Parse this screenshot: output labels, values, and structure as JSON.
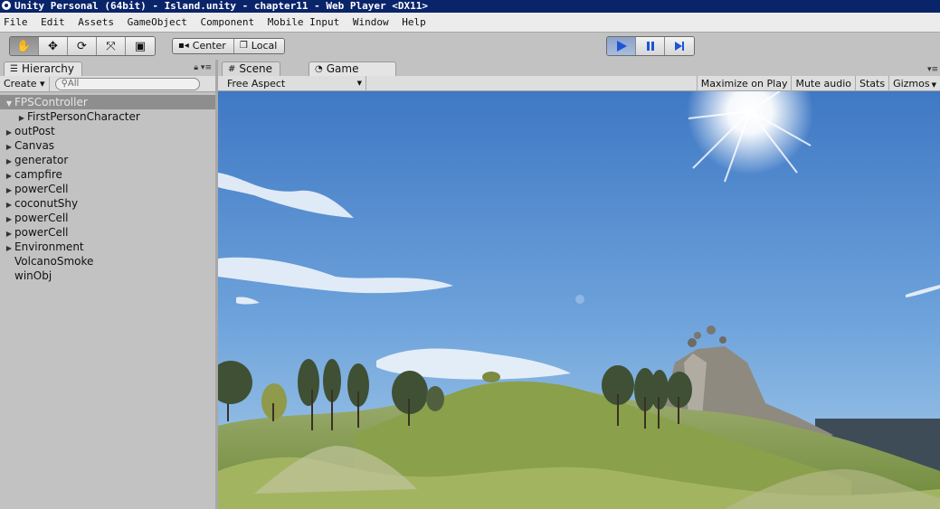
{
  "window": {
    "title": "Unity Personal (64bit) - Island.unity - chapter11 - Web Player <DX11>"
  },
  "menu": [
    "File",
    "Edit",
    "Assets",
    "GameObject",
    "Component",
    "Mobile Input",
    "Window",
    "Help"
  ],
  "toolbar": {
    "transform_tools": [
      {
        "name": "hand-tool-icon",
        "glyph": "✋"
      },
      {
        "name": "move-tool-icon",
        "glyph": "✥"
      },
      {
        "name": "rotate-tool-icon",
        "glyph": "⟳"
      },
      {
        "name": "scale-tool-icon",
        "glyph": "⤧"
      },
      {
        "name": "rect-tool-icon",
        "glyph": "▣"
      }
    ],
    "pivot_label": "Center",
    "space_label": "Local"
  },
  "hierarchy": {
    "tab_label": "Hierarchy",
    "create_label": "Create",
    "search_placeholder": "All",
    "items": [
      {
        "label": "FPSController",
        "depth": 0,
        "arrow": "down",
        "selected": true
      },
      {
        "label": "FirstPersonCharacter",
        "depth": 1,
        "arrow": "right",
        "selected": false
      },
      {
        "label": "outPost",
        "depth": 0,
        "arrow": "right",
        "selected": false
      },
      {
        "label": "Canvas",
        "depth": 0,
        "arrow": "right",
        "selected": false
      },
      {
        "label": "generator",
        "depth": 0,
        "arrow": "right",
        "selected": false
      },
      {
        "label": "campfire",
        "depth": 0,
        "arrow": "right",
        "selected": false
      },
      {
        "label": "powerCell",
        "depth": 0,
        "arrow": "right",
        "selected": false
      },
      {
        "label": "coconutShy",
        "depth": 0,
        "arrow": "right",
        "selected": false
      },
      {
        "label": "powerCell",
        "depth": 0,
        "arrow": "right",
        "selected": false
      },
      {
        "label": "powerCell",
        "depth": 0,
        "arrow": "right",
        "selected": false
      },
      {
        "label": "Environment",
        "depth": 0,
        "arrow": "right",
        "selected": false
      },
      {
        "label": "VolcanoSmoke",
        "depth": 0,
        "arrow": "none",
        "selected": false
      },
      {
        "label": "winObj",
        "depth": 0,
        "arrow": "none",
        "selected": false
      }
    ]
  },
  "view_tabs": {
    "scene_label": "Scene",
    "game_label": "Game"
  },
  "game_toolbar": {
    "aspect_label": "Free Aspect",
    "maximize_label": "Maximize on Play",
    "mute_label": "Mute audio",
    "stats_label": "Stats",
    "gizmos_label": "Gizmos"
  },
  "colors": {
    "title_bar": "#0a246a",
    "selection": "#8e8e8e",
    "play_active": "#3a6fd8"
  }
}
